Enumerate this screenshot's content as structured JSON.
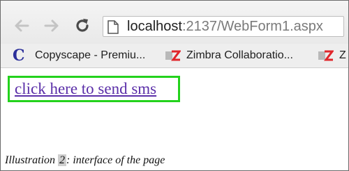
{
  "browser": {
    "url_host": "localhost",
    "url_path": ":2137/WebForm1.aspx",
    "icons": {
      "back": "back-arrow-icon",
      "forward": "forward-arrow-icon",
      "reload": "reload-icon",
      "page": "page-icon"
    }
  },
  "bookmarks": [
    {
      "label": "Copyscape - Premiu...",
      "icon": "copyscape-icon"
    },
    {
      "label": "Zimbra Collaboratio...",
      "icon": "zimbra-icon"
    },
    {
      "label": "Z",
      "icon": "zimbra-icon"
    }
  ],
  "page": {
    "link_text": "click here to send sms",
    "link_color": "#5a2ea8",
    "highlight_color": "#23d21c"
  },
  "caption": {
    "prefix": "Illustration ",
    "number": "2",
    "suffix": ": interface of the page"
  }
}
